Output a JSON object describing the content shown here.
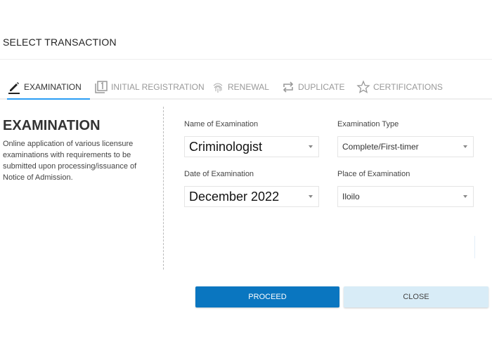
{
  "header": {
    "title": "SELECT TRANSACTION"
  },
  "tabs": [
    {
      "label": "EXAMINATION",
      "icon": "pencil-icon",
      "active": true
    },
    {
      "label": "INITIAL REGISTRATION",
      "icon": "filter-1-icon",
      "active": false
    },
    {
      "label": "RENEWAL",
      "icon": "fingerprint-icon",
      "active": false
    },
    {
      "label": "DUPLICATE",
      "icon": "repeat-icon",
      "active": false
    },
    {
      "label": "CERTIFICATIONS",
      "icon": "star-outline-icon",
      "active": false
    }
  ],
  "panel": {
    "heading": "EXAMINATION",
    "description": "Online application of various licensure examinations with requirements to be submitted upon processing/issuance of Notice of Admission."
  },
  "form": {
    "name_of_exam": {
      "label": "Name of Examination",
      "value": "Criminologist"
    },
    "exam_type": {
      "label": "Examination Type",
      "value": "Complete/First-timer"
    },
    "date_of_exam": {
      "label": "Date of Examination",
      "value": "December 2022"
    },
    "place_of_exam": {
      "label": "Place of Examination",
      "value": "Iloilo"
    }
  },
  "actions": {
    "proceed": "PROCEED",
    "close": "CLOSE"
  },
  "colors": {
    "primary": "#0a76c0",
    "secondary": "#d8ecf7",
    "tab_indicator": "#2a9df4"
  }
}
